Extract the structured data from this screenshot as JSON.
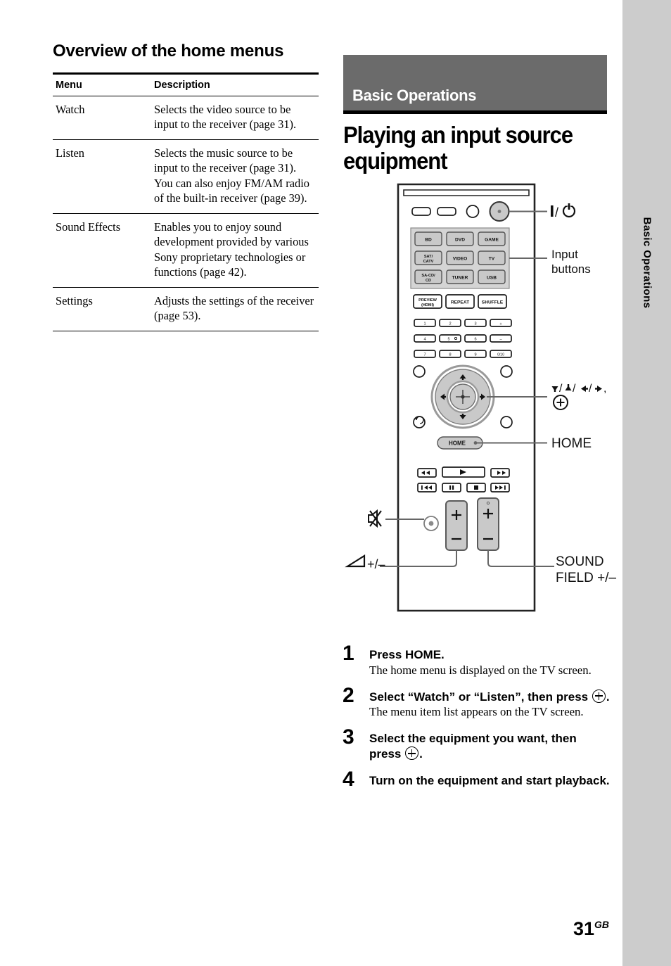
{
  "page": {
    "number": "31",
    "region_code": "GB"
  },
  "side_tab": {
    "label": "Basic Operations"
  },
  "left_column": {
    "section_title": "Overview of the home menus",
    "table": {
      "headers": [
        "Menu",
        "Description"
      ],
      "rows": [
        {
          "menu": "Watch",
          "description": "Selects the video source to be input to the receiver (page 31)."
        },
        {
          "menu": "Listen",
          "description": "Selects the music source to be input to the receiver (page 31). You can also enjoy FM/AM radio of the built-in receiver (page 39)."
        },
        {
          "menu": "Sound Effects",
          "description": "Enables you to enjoy sound development provided by various Sony proprietary technologies or functions (page 42)."
        },
        {
          "menu": "Settings",
          "description": "Adjusts the settings of the receiver (page 53)."
        }
      ]
    }
  },
  "right_column": {
    "banner_label": "Basic Operations",
    "heading": "Playing an input source equipment"
  },
  "figure": {
    "callouts": {
      "power": "I/⏻",
      "input_buttons": [
        "Input",
        "buttons"
      ],
      "navigation": "⬆/⬇/⬅/➡,",
      "home": "HOME",
      "volume": "+/−",
      "sound_field": [
        "SOUND",
        "FIELD +/−"
      ]
    },
    "remote": {
      "input_buttons": [
        [
          "BD",
          "DVD",
          "GAME"
        ],
        [
          "SAT/\nCATV",
          "VIDEO",
          "TV"
        ],
        [
          "SA-CD/\nCD",
          "TUNER",
          "USB"
        ]
      ],
      "function_buttons": [
        "PREVIEW\n(HDMI)",
        "REPEAT",
        "SHUFFLE"
      ],
      "numeric_rows": [
        [
          "1",
          "2",
          "3",
          "+"
        ],
        [
          "4",
          "5",
          "6",
          "−"
        ],
        [
          "7",
          "8",
          "9",
          "0/10"
        ]
      ],
      "home_button": "HOME",
      "volume_rocker": [
        "+",
        "−"
      ],
      "sound_field_rocker": [
        "+",
        "−"
      ]
    }
  },
  "steps": [
    {
      "number": "1",
      "heading": "Press HOME.",
      "description": "The home menu is displayed on the TV screen."
    },
    {
      "number": "2",
      "heading_part1": "Select “Watch” or “Listen”, then press",
      "heading_part2": ".",
      "description": "The menu item list appears on the TV screen."
    },
    {
      "number": "3",
      "heading_part1": "Select the equipment you want, then press",
      "heading_part2": ".",
      "description": ""
    },
    {
      "number": "4",
      "heading": "Turn on the equipment and start playback.",
      "description": ""
    }
  ],
  "colors": {
    "banner_gray": "#6b6b6b",
    "tab_gray": "#cccccc",
    "button_gray": "#c9c9c9",
    "panel_gray": "#d4d4d4"
  }
}
